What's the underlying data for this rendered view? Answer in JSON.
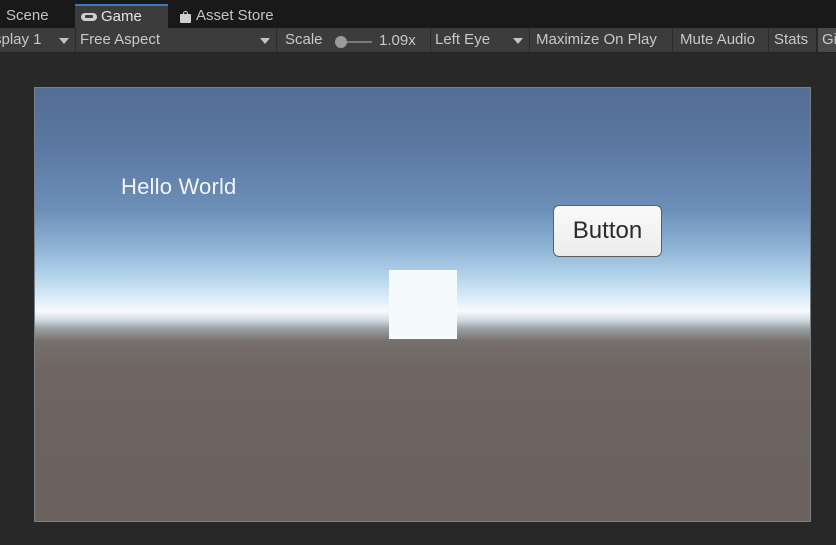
{
  "tabs": {
    "scene": "Scene",
    "game": "Game",
    "asset_store": "Asset Store"
  },
  "toolbar": {
    "display": "splay 1",
    "aspect": "Free Aspect",
    "scale_label": "Scale",
    "scale_value": "1.09x",
    "scale_level": 0.05,
    "eye": "Left Eye",
    "maximize": "Maximize On Play",
    "mute": "Mute Audio",
    "stats": "Stats",
    "gizmos": "Gi"
  },
  "game": {
    "hello_text": "Hello World",
    "button_label": "Button"
  },
  "colors": {
    "editor_bg": "#282828",
    "toolbar_bg": "#3c3c3c",
    "active_tab_accent": "#3a79bb",
    "sky_top": "#546d94",
    "horizon": "#f7fbfd",
    "ground": "#6b625d"
  },
  "icons": {
    "game_tab": "gamepad-icon",
    "asset_store_tab": "shopping-bag-icon"
  }
}
